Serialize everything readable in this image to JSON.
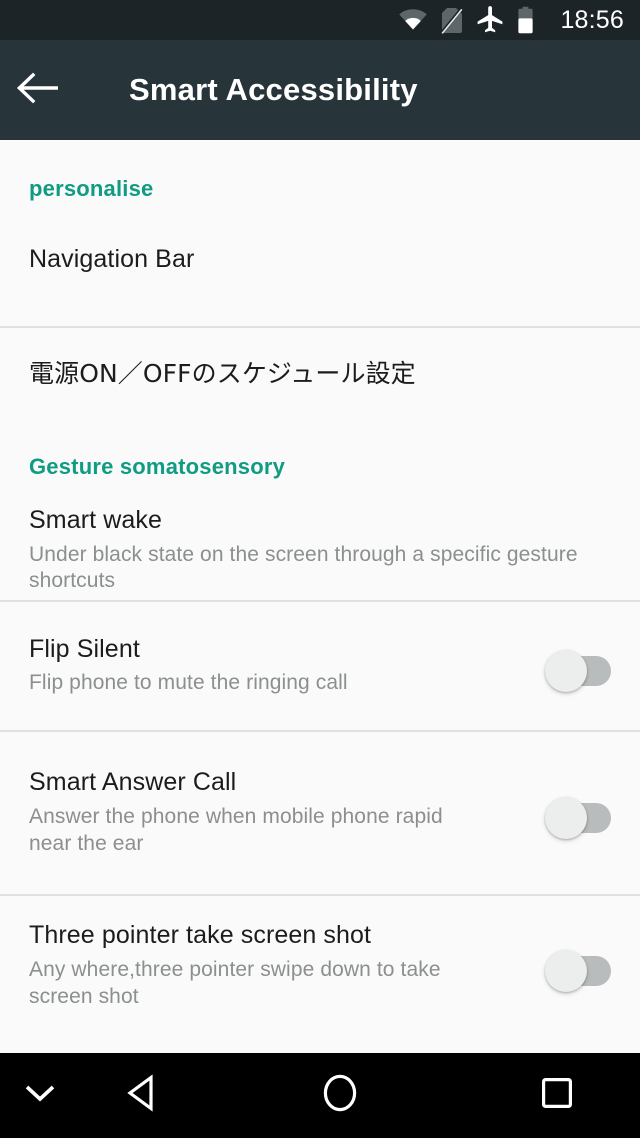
{
  "status_bar": {
    "time": "18:56",
    "icons": [
      {
        "name": "wifi-icon",
        "label": "Wi-Fi"
      },
      {
        "name": "no-sim-icon",
        "label": "No SIM card"
      },
      {
        "name": "airplane-mode-icon",
        "label": "Airplane mode"
      },
      {
        "name": "battery-icon",
        "label": "Battery"
      }
    ],
    "background": "#1d2427"
  },
  "app_bar": {
    "title": "Smart Accessibility",
    "back_label": "Back",
    "background": "#27343a",
    "title_color": "#ffffff"
  },
  "theme": {
    "accent": "#0f9c82",
    "page_background": "#fafafa",
    "primary_text": "#1c1c1c",
    "secondary_text": "#8b8f90",
    "divider": "#e0e0e0",
    "switch_track_off": "#b9bcbd",
    "switch_thumb_off": "#eceded"
  },
  "sections": [
    {
      "header": "personalise",
      "items": [
        {
          "title": "Navigation Bar",
          "subtitle": "",
          "has_switch": false,
          "switch_on": false,
          "japanese": false
        },
        {
          "title": "電源ON／OFFのスケジュール設定",
          "subtitle": "",
          "has_switch": false,
          "switch_on": false,
          "japanese": true
        }
      ]
    },
    {
      "header": "Gesture somatosensory",
      "items": [
        {
          "title": "Smart wake",
          "subtitle": "Under black state on the screen through a specific gesture shortcuts",
          "has_switch": false,
          "switch_on": false,
          "japanese": false
        },
        {
          "title": "Flip Silent",
          "subtitle": "Flip phone to mute the ringing call",
          "has_switch": true,
          "switch_on": false,
          "japanese": false
        },
        {
          "title": "Smart Answer Call",
          "subtitle": "Answer the phone when mobile phone rapid near the ear",
          "has_switch": true,
          "switch_on": false,
          "japanese": false
        },
        {
          "title": "Three pointer take screen shot",
          "subtitle": "Any where,three pointer swipe down to take screen shot",
          "has_switch": true,
          "switch_on": false,
          "japanese": false
        }
      ]
    }
  ],
  "nav_bar": {
    "background": "#000000",
    "buttons": [
      {
        "name": "hide-keyboard-icon",
        "label": "Hide"
      },
      {
        "name": "back-triangle-icon",
        "label": "Back"
      },
      {
        "name": "home-circle-icon",
        "label": "Home"
      },
      {
        "name": "recents-square-icon",
        "label": "Recents"
      }
    ]
  }
}
